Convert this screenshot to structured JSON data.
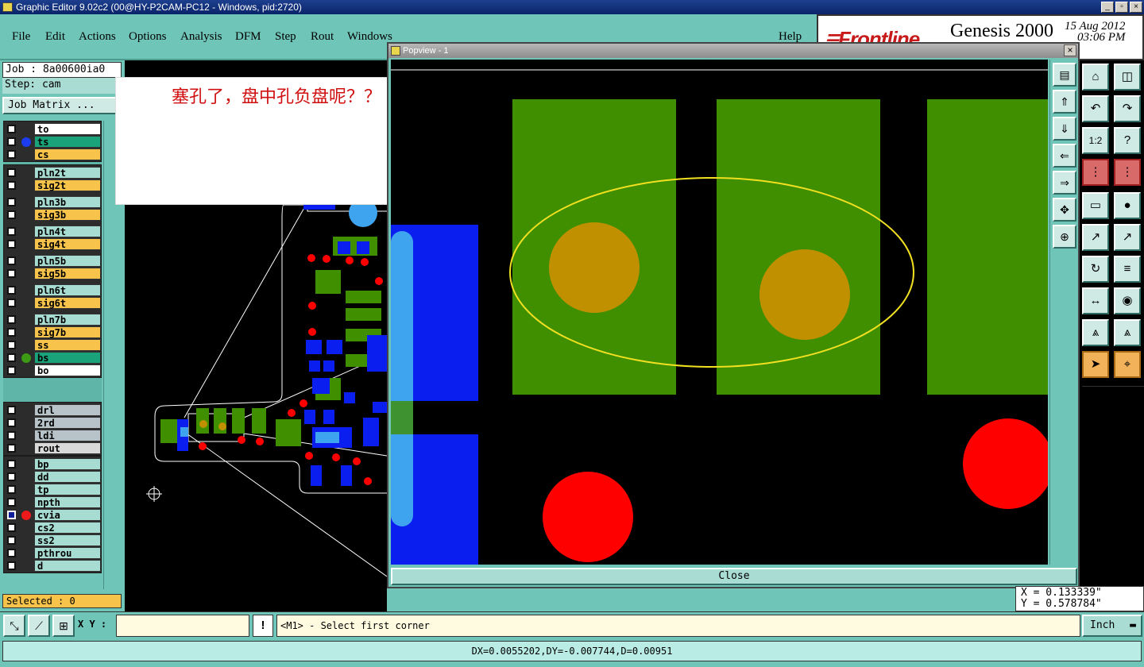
{
  "window": {
    "title": "Graphic Editor 9.02c2 (00@HY-P2CAM-PC12 - Windows, pid:2720)",
    "buttons": [
      "_",
      "▫",
      "×"
    ]
  },
  "menu": {
    "items": [
      "File",
      "Edit",
      "Actions",
      "Options",
      "Analysis",
      "DFM",
      "Step",
      "Rout",
      "Windows"
    ],
    "help": "Help"
  },
  "brand": {
    "logo": "Frontline",
    "product": "Genesis 2000",
    "date": "15 Aug 2012",
    "time": "03:06 PM"
  },
  "job": {
    "job": "Job : 8a00600ia0",
    "step": "Step: cam",
    "matrix": "Job Matrix ..."
  },
  "layers": [
    {
      "name": "to",
      "color": "#ffffff"
    },
    {
      "name": "ts",
      "color": "#1aa37a",
      "dot": "#1b3cf0"
    },
    {
      "name": "cs",
      "color": "#f7c34a"
    },
    {
      "name": "pln2t",
      "color": "#a7dcd2"
    },
    {
      "name": "sig2t",
      "color": "#f7c34a"
    },
    {
      "name": "pln3b",
      "color": "#a7dcd2"
    },
    {
      "name": "sig3b",
      "color": "#f7c34a"
    },
    {
      "name": "pln4t",
      "color": "#a7dcd2"
    },
    {
      "name": "sig4t",
      "color": "#f7c34a"
    },
    {
      "name": "pln5b",
      "color": "#a7dcd2"
    },
    {
      "name": "sig5b",
      "color": "#f7c34a"
    },
    {
      "name": "pln6t",
      "color": "#a7dcd2"
    },
    {
      "name": "sig6t",
      "color": "#f7c34a"
    },
    {
      "name": "pln7b",
      "color": "#a7dcd2"
    },
    {
      "name": "sig7b",
      "color": "#f7c34a"
    },
    {
      "name": "ss",
      "color": "#f7c34a"
    },
    {
      "name": "bs",
      "color": "#1aa37a",
      "dot": "#3c9a14"
    },
    {
      "name": "bo",
      "color": "#ffffff"
    },
    {
      "name": "drl",
      "color": "#b7c3c8"
    },
    {
      "name": "2rd",
      "color": "#b7c3c8"
    },
    {
      "name": "ldi",
      "color": "#b7c3c8"
    },
    {
      "name": "rout",
      "color": "#d9d9d9"
    },
    {
      "name": "bp",
      "color": "#a7dcd2"
    },
    {
      "name": "dd",
      "color": "#a7dcd2"
    },
    {
      "name": "tp",
      "color": "#a7dcd2"
    },
    {
      "name": "npth",
      "color": "#a7dcd2"
    },
    {
      "name": "cvia",
      "color": "#a7dcd2",
      "dot": "#f01a1a",
      "checked": true
    },
    {
      "name": "cs2",
      "color": "#a7dcd2"
    },
    {
      "name": "ss2",
      "color": "#a7dcd2"
    },
    {
      "name": "pthrou",
      "color": "#a7dcd2"
    },
    {
      "name": "d",
      "color": "#a7dcd2"
    }
  ],
  "selected": "Selected : 0",
  "annotation": "塞孔了，盘中孔负盘呢？？",
  "popup": {
    "title": "Popview - 1",
    "close_label": "Close"
  },
  "coords": {
    "x": "X = 0.133339\"",
    "y": "Y = 0.578784\""
  },
  "bottom": {
    "xy_label": "X Y :",
    "excl": "!",
    "message": "<M1> - Select first corner",
    "unit": "Inch"
  },
  "status": "DX=0.0055202,DY=-0.007744,D=0.00951",
  "colors": {
    "copper": "#3f8f00",
    "via": "#c09000",
    "hole": "#ff0000",
    "blue": "#0a1ef0",
    "lightblue": "#3fa4f0",
    "ellipse": "#f0e020"
  }
}
